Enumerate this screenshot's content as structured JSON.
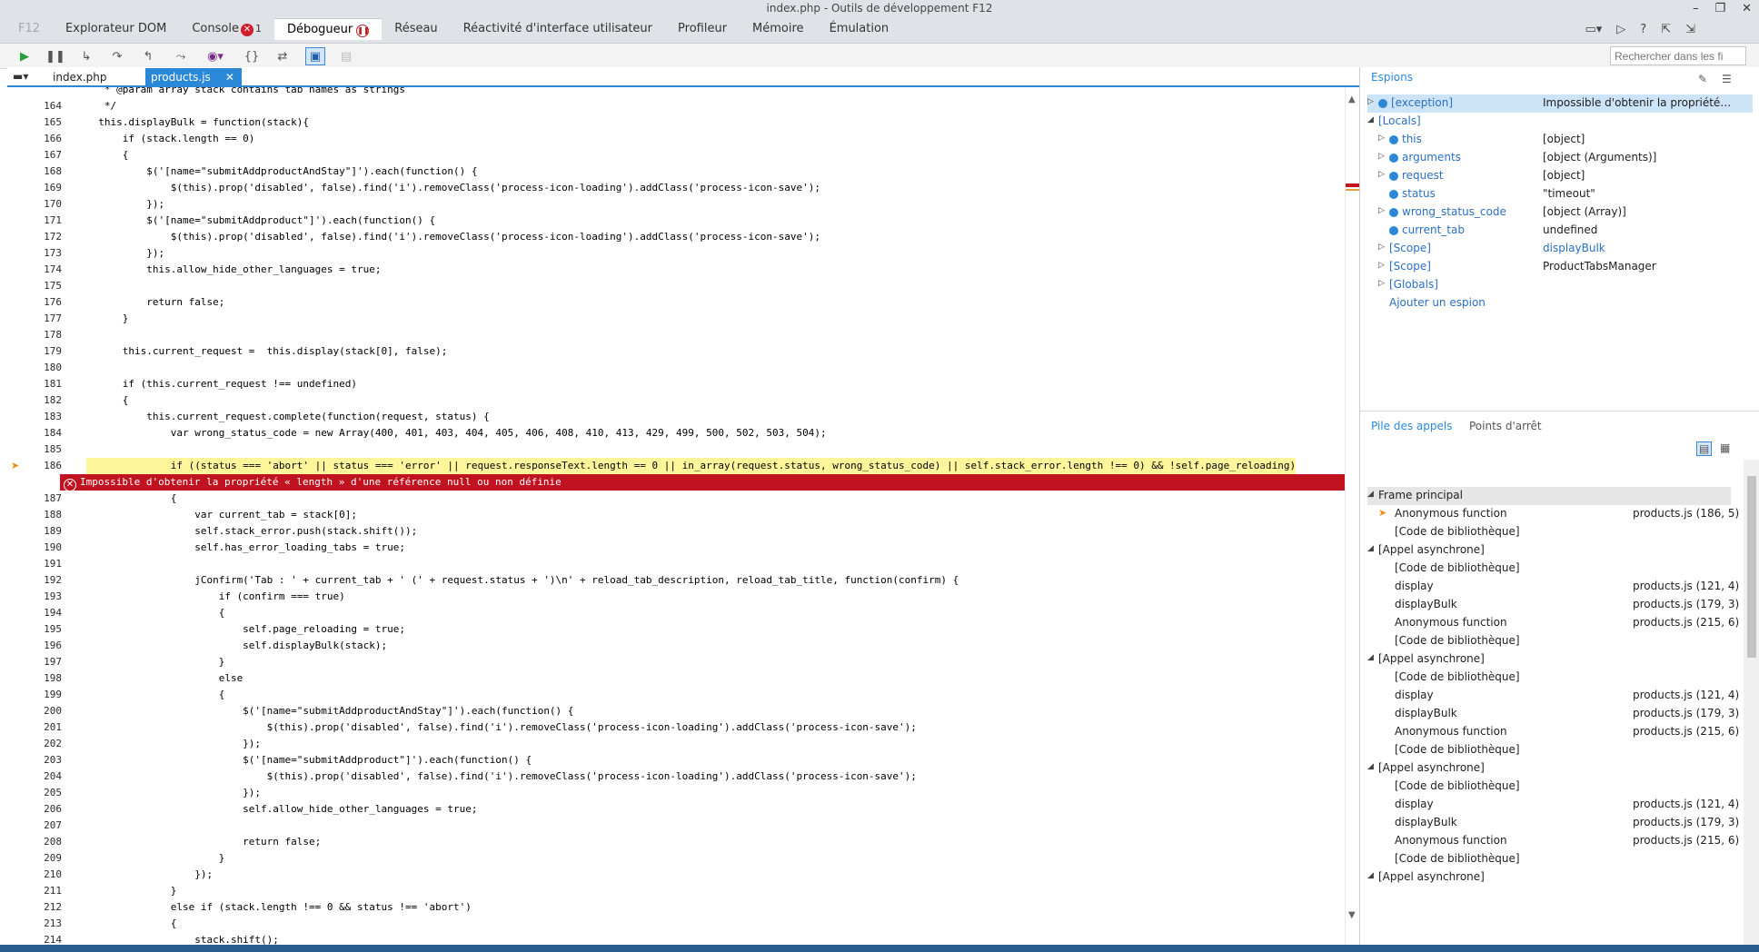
{
  "window": {
    "title": "index.php - Outils de développement F12",
    "controls": [
      "–",
      "❐",
      "✕"
    ]
  },
  "main_tabs": [
    {
      "label": "F12"
    },
    {
      "label": "Explorateur DOM"
    },
    {
      "label": "Console",
      "badge": "1"
    },
    {
      "label": "Débogueur"
    },
    {
      "label": "Réseau"
    },
    {
      "label": "Réactivité d'interface utilisateur"
    },
    {
      "label": "Profileur"
    },
    {
      "label": "Mémoire"
    },
    {
      "label": "Émulation"
    }
  ],
  "right_tools": [
    "▭▾",
    "▷",
    "?",
    "⇱",
    "⇲"
  ],
  "search": {
    "placeholder": "Rechercher dans les fi",
    "value": ""
  },
  "file_tabs": [
    {
      "label": "index.php"
    },
    {
      "label": "products.js",
      "close": "✕"
    }
  ],
  "code_lines": [
    {
      "n": "",
      "t": "   * @param array stack contains tab names as strings"
    },
    {
      "n": "164",
      "t": "   */"
    },
    {
      "n": "165",
      "t": "  this.displayBulk = function(stack){"
    },
    {
      "n": "166",
      "t": "      if (stack.length == 0)"
    },
    {
      "n": "167",
      "t": "      {"
    },
    {
      "n": "168",
      "t": "          $('[name=\"submitAddproductAndStay\"]').each(function() {"
    },
    {
      "n": "169",
      "t": "              $(this).prop('disabled', false).find('i').removeClass('process-icon-loading').addClass('process-icon-save');"
    },
    {
      "n": "170",
      "t": "          });"
    },
    {
      "n": "171",
      "t": "          $('[name=\"submitAddproduct\"]').each(function() {"
    },
    {
      "n": "172",
      "t": "              $(this).prop('disabled', false).find('i').removeClass('process-icon-loading').addClass('process-icon-save');"
    },
    {
      "n": "173",
      "t": "          });"
    },
    {
      "n": "174",
      "t": "          this.allow_hide_other_languages = true;"
    },
    {
      "n": "175",
      "t": ""
    },
    {
      "n": "176",
      "t": "          return false;"
    },
    {
      "n": "177",
      "t": "      }"
    },
    {
      "n": "178",
      "t": ""
    },
    {
      "n": "179",
      "t": "      this.current_request =  this.display(stack[0], false);"
    },
    {
      "n": "180",
      "t": ""
    },
    {
      "n": "181",
      "t": "      if (this.current_request !== undefined)"
    },
    {
      "n": "182",
      "t": "      {"
    },
    {
      "n": "183",
      "t": "          this.current_request.complete(function(request, status) {"
    },
    {
      "n": "184",
      "t": "              var wrong_status_code = new Array(400, 401, 403, 404, 405, 406, 408, 410, 413, 429, 499, 500, 502, 503, 504);"
    },
    {
      "n": "185",
      "t": ""
    },
    {
      "n": "186",
      "t": "              if ((status === 'abort' || status === 'error' || request.responseText.length == 0 || in_array(request.status, wrong_status_code) || self.stack_error.length !== 0) && !self.page_reloading)"
    },
    {
      "n": "187",
      "t": "              {"
    },
    {
      "n": "188",
      "t": "                  var current_tab = stack[0];"
    },
    {
      "n": "189",
      "t": "                  self.stack_error.push(stack.shift());"
    },
    {
      "n": "190",
      "t": "                  self.has_error_loading_tabs = true;"
    },
    {
      "n": "191",
      "t": ""
    },
    {
      "n": "192",
      "t": "                  jConfirm('Tab : ' + current_tab + ' (' + request.status + ')\\n' + reload_tab_description, reload_tab_title, function(confirm) {"
    },
    {
      "n": "193",
      "t": "                      if (confirm === true)"
    },
    {
      "n": "194",
      "t": "                      {"
    },
    {
      "n": "195",
      "t": "                          self.page_reloading = true;"
    },
    {
      "n": "196",
      "t": "                          self.displayBulk(stack);"
    },
    {
      "n": "197",
      "t": "                      }"
    },
    {
      "n": "198",
      "t": "                      else"
    },
    {
      "n": "199",
      "t": "                      {"
    },
    {
      "n": "200",
      "t": "                          $('[name=\"submitAddproductAndStay\"]').each(function() {"
    },
    {
      "n": "201",
      "t": "                              $(this).prop('disabled', false).find('i').removeClass('process-icon-loading').addClass('process-icon-save');"
    },
    {
      "n": "202",
      "t": "                          });"
    },
    {
      "n": "203",
      "t": "                          $('[name=\"submitAddproduct\"]').each(function() {"
    },
    {
      "n": "204",
      "t": "                              $(this).prop('disabled', false).find('i').removeClass('process-icon-loading').addClass('process-icon-save');"
    },
    {
      "n": "205",
      "t": "                          });"
    },
    {
      "n": "206",
      "t": "                          self.allow_hide_other_languages = true;"
    },
    {
      "n": "207",
      "t": ""
    },
    {
      "n": "208",
      "t": "                          return false;"
    },
    {
      "n": "209",
      "t": "                      }"
    },
    {
      "n": "210",
      "t": "                  });"
    },
    {
      "n": "211",
      "t": "              }"
    },
    {
      "n": "212",
      "t": "              else if (stack.length !== 0 && status !== 'abort')"
    },
    {
      "n": "213",
      "t": "              {"
    },
    {
      "n": "214",
      "t": "                  stack.shift();"
    }
  ],
  "current_line": "186",
  "error_banner": {
    "icon": "✕",
    "text": "Impossible d'obtenir la propriété « length » d'une référence null ou non définie"
  },
  "watches": {
    "title": "Espions",
    "rows": [
      {
        "name": "[exception]",
        "value": "Impossible d'obtenir la propriété…",
        "level": 0,
        "expander": "▷",
        "icon": true,
        "sel": true
      },
      {
        "name": "[Locals]",
        "value": "",
        "level": 0,
        "expander": "◢",
        "icon": false
      },
      {
        "name": "this",
        "value": "[object]",
        "level": 1,
        "expander": "▷",
        "icon": true
      },
      {
        "name": "arguments",
        "value": "[object (Arguments)]",
        "level": 1,
        "expander": "▷",
        "icon": true
      },
      {
        "name": "request",
        "value": "[object]",
        "level": 1,
        "expander": "▷",
        "icon": true
      },
      {
        "name": "status",
        "value": "\"timeout\"",
        "level": 1,
        "expander": "",
        "icon": true
      },
      {
        "name": "wrong_status_code",
        "value": "[object (Array)]",
        "level": 1,
        "expander": "▷",
        "icon": true
      },
      {
        "name": "current_tab",
        "value": "undefined",
        "level": 1,
        "expander": "",
        "icon": true
      },
      {
        "name": "[Scope]",
        "value": "displayBulk",
        "level": 1,
        "expander": "▷",
        "icon": false,
        "link": true
      },
      {
        "name": "[Scope]",
        "value": "ProductTabsManager",
        "level": 1,
        "expander": "▷",
        "icon": false
      },
      {
        "name": "[Globals]",
        "value": "",
        "level": 1,
        "expander": "▷",
        "icon": false
      }
    ],
    "add_label": "Ajouter un espion"
  },
  "callstack": {
    "tabs": [
      "Pile des appels",
      "Points d'arrêt"
    ],
    "rows": [
      {
        "kind": "group",
        "name": "Frame principal",
        "loc": "",
        "hl": true
      },
      {
        "kind": "item",
        "name": "Anonymous function",
        "loc": "products.js (186, 5)",
        "current": true
      },
      {
        "kind": "item",
        "name": "[Code de bibliothèque]",
        "loc": ""
      },
      {
        "kind": "group",
        "name": "[Appel asynchrone]",
        "loc": ""
      },
      {
        "kind": "item",
        "name": "[Code de bibliothèque]",
        "loc": ""
      },
      {
        "kind": "item",
        "name": "display",
        "loc": "products.js (121, 4)"
      },
      {
        "kind": "item",
        "name": "displayBulk",
        "loc": "products.js (179, 3)"
      },
      {
        "kind": "item",
        "name": "Anonymous function",
        "loc": "products.js (215, 6)"
      },
      {
        "kind": "item",
        "name": "[Code de bibliothèque]",
        "loc": ""
      },
      {
        "kind": "group",
        "name": "[Appel asynchrone]",
        "loc": ""
      },
      {
        "kind": "item",
        "name": "[Code de bibliothèque]",
        "loc": ""
      },
      {
        "kind": "item",
        "name": "display",
        "loc": "products.js (121, 4)"
      },
      {
        "kind": "item",
        "name": "displayBulk",
        "loc": "products.js (179, 3)"
      },
      {
        "kind": "item",
        "name": "Anonymous function",
        "loc": "products.js (215, 6)"
      },
      {
        "kind": "item",
        "name": "[Code de bibliothèque]",
        "loc": ""
      },
      {
        "kind": "group",
        "name": "[Appel asynchrone]",
        "loc": ""
      },
      {
        "kind": "item",
        "name": "[Code de bibliothèque]",
        "loc": ""
      },
      {
        "kind": "item",
        "name": "display",
        "loc": "products.js (121, 4)"
      },
      {
        "kind": "item",
        "name": "displayBulk",
        "loc": "products.js (179, 3)"
      },
      {
        "kind": "item",
        "name": "Anonymous function",
        "loc": "products.js (215, 6)"
      },
      {
        "kind": "item",
        "name": "[Code de bibliothèque]",
        "loc": ""
      },
      {
        "kind": "group",
        "name": "[Appel asynchrone]",
        "loc": ""
      }
    ]
  },
  "colors": {
    "accent": "#2b88d8",
    "error": "#c1121f",
    "current_line": "#fff59a",
    "arrow": "#f08a12"
  }
}
